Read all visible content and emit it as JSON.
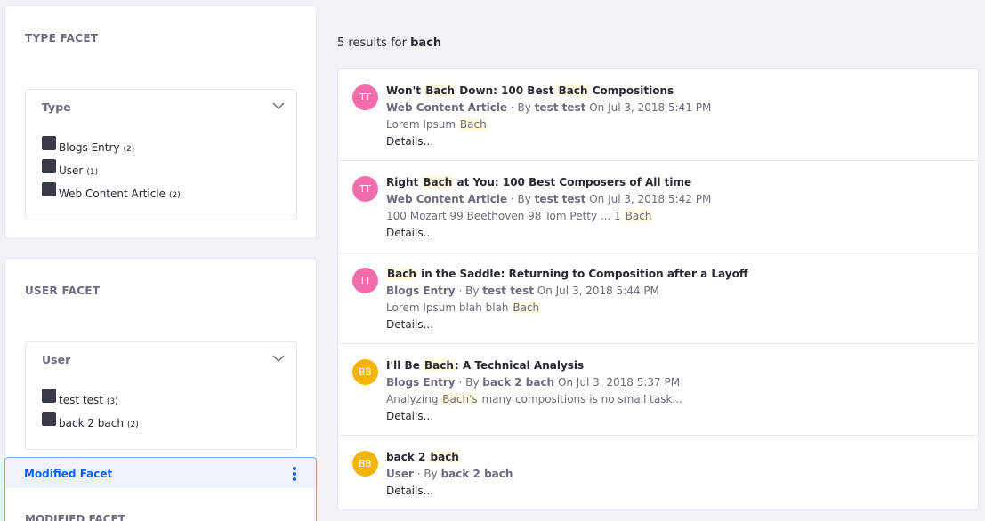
{
  "type_facet": {
    "title": "TYPE FACET",
    "header": "Type",
    "items": [
      {
        "label": "Blogs Entry",
        "count": "(2)"
      },
      {
        "label": "User",
        "count": "(1)"
      },
      {
        "label": "Web Content Article",
        "count": "(2)"
      }
    ]
  },
  "user_facet": {
    "title": "USER FACET",
    "header": "User",
    "items": [
      {
        "label": "test test",
        "count": "(3)"
      },
      {
        "label": "back 2 bach",
        "count": "(2)"
      }
    ]
  },
  "modified_facet": {
    "bar_label": "Modified Facet",
    "title": "MODIFIED FACET"
  },
  "summary": {
    "prefix": "5 results for",
    "keyword": "bach"
  },
  "results": [
    {
      "initials": "TT",
      "title": {
        "p1": "Won't ",
        "m1": "Bach",
        "p2": " Down: 100 Best ",
        "m2": "Bach",
        "p3": " Compositions"
      },
      "type": "Web Content Article",
      "by": "· By",
      "author": "test test",
      "date": "On Jul 3, 2018 5:41 PM",
      "snippet": {
        "p1": "Lorem Ipsum ",
        "m1": "Bach",
        "p2": ""
      },
      "details": "Details..."
    },
    {
      "initials": "TT",
      "title": {
        "p1": "Right ",
        "m1": "Bach",
        "p2": " at You: 100 Best Composers of All time"
      },
      "type": "Web Content Article",
      "by": "· By",
      "author": "test test",
      "date": "On Jul 3, 2018 5:42 PM",
      "snippet": {
        "p1": "100 Mozart 99 Beethoven 98 Tom Petty ... 1 ",
        "m1": "Bach",
        "p2": ""
      },
      "details": "Details..."
    },
    {
      "initials": "TT",
      "title": {
        "p1": "",
        "m1": "Bach",
        "p2": " in the Saddle: Returning to Composition after a Layoff"
      },
      "type": "Blogs Entry",
      "by": "· By",
      "author": "test test",
      "date": "On Jul 3, 2018 5:44 PM",
      "snippet": {
        "p1": "Lorem Ipsum blah blah ",
        "m1": "Bach",
        "p2": ""
      },
      "details": "Details..."
    },
    {
      "initials": "BB",
      "title": {
        "p1": "I'll Be ",
        "m1": "Bach",
        "p2": ": A Technical Analysis"
      },
      "type": "Blogs Entry",
      "by": "· By",
      "author": "back 2 bach",
      "date": "On Jul 3, 2018 5:37 PM",
      "snippet": {
        "p1": "Analyzing ",
        "m1": "Bach's",
        "p2": " many compositions is no small task..."
      },
      "details": "Details..."
    },
    {
      "initials": "BB",
      "title": {
        "p1": "back 2 ",
        "m1": "bach",
        "p2": ""
      },
      "type": "User",
      "by": "· By",
      "author": "back 2 bach",
      "details": "Details..."
    }
  ],
  "colors": {
    "avatar_pink": "#f26dac",
    "avatar_yellow": "#f5b400",
    "accent": "#0b5fff"
  }
}
